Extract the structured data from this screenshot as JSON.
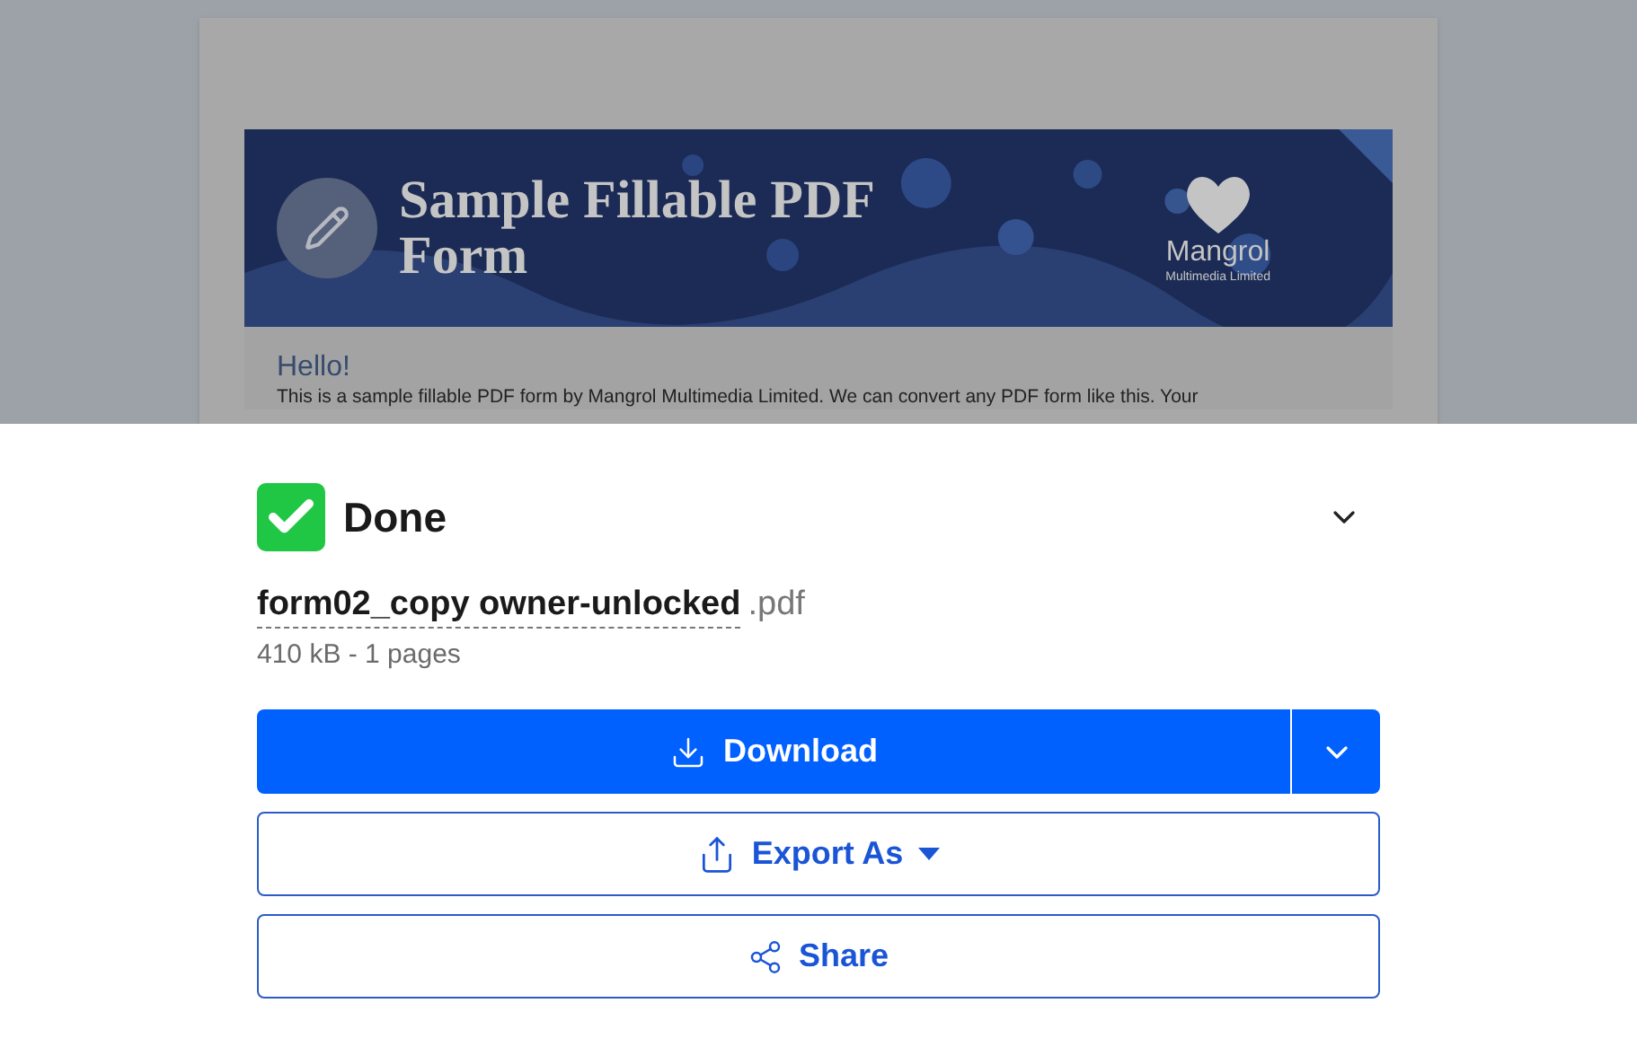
{
  "preview": {
    "banner_title": "Sample Fillable PDF Form",
    "logo_name": "Mangrol",
    "logo_tagline": "Multimedia Limited",
    "heading": "Hello!",
    "paragraph": "This is a sample fillable PDF form by Mangrol Multimedia Limited. We can convert any PDF form like this. Your"
  },
  "status": {
    "title": "Done"
  },
  "file": {
    "name": "form02_copy owner-unlocked",
    "extension": ".pdf",
    "meta": "410 kB - 1 pages"
  },
  "actions": [
    {
      "kind": "primary",
      "label": "Download"
    },
    {
      "kind": "export",
      "label": "Export As"
    },
    {
      "kind": "share",
      "label": "Share"
    }
  ]
}
